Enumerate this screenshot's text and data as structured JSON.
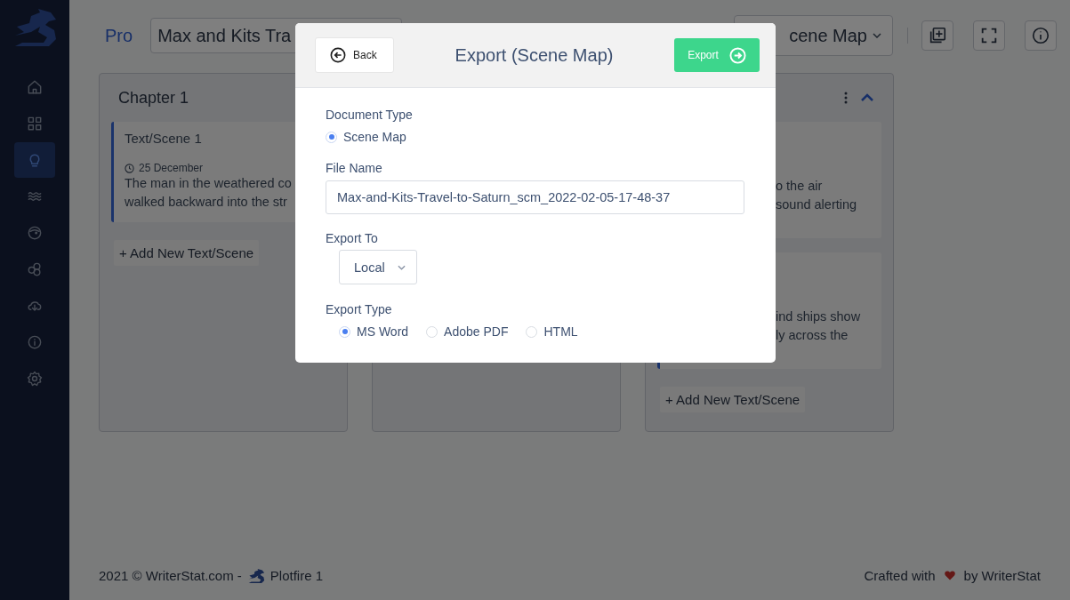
{
  "sidebar": {
    "items": [
      {
        "kind": "home",
        "selected": false
      },
      {
        "kind": "grid",
        "selected": false
      },
      {
        "kind": "bulb",
        "selected": true
      },
      {
        "kind": "waves",
        "selected": false
      },
      {
        "kind": "face",
        "selected": false
      },
      {
        "kind": "circles",
        "selected": false
      },
      {
        "kind": "cloud",
        "selected": false
      },
      {
        "kind": "info",
        "selected": false
      },
      {
        "kind": "gear",
        "selected": false
      }
    ]
  },
  "topbar": {
    "plan": "Pro",
    "title": "Max and Kits Tra",
    "view": "cene Map"
  },
  "columns": [
    {
      "title": "Chapter 1",
      "cards": [
        {
          "title": "Text/Scene 1",
          "date": "25 December",
          "lines": [
            "The man in the weathered co",
            "walked backward into the str"
          ],
          "highlighted": true
        }
      ],
      "add_button": "+ Add New Text/Scene"
    },
    {},
    {
      "expanded": true,
      "cards": [
        {
          "lines": [
            "o the air",
            "sound alerting"
          ]
        },
        {
          "lines": [
            "ind ships show",
            "ly across the"
          ],
          "highlighted": true
        }
      ],
      "add_button": "+ Add New Text/Scene"
    }
  ],
  "dialog": {
    "back": "Back",
    "title": "Export (Scene Map)",
    "export": "Export",
    "document_type": {
      "label": "Document Type",
      "options": [
        {
          "label": "Scene Map",
          "selected": true
        }
      ]
    },
    "file_name": {
      "label": "File Name",
      "value": "Max-and-Kits-Travel-to-Saturn_scm_2022-02-05-17-48-37"
    },
    "export_to": {
      "label": "Export To",
      "value": "Local"
    },
    "export_type": {
      "label": "Export Type",
      "options": [
        {
          "label": "MS Word",
          "selected": true
        },
        {
          "label": "Adobe PDF",
          "selected": false
        },
        {
          "label": "HTML",
          "selected": false
        }
      ]
    }
  },
  "footer": {
    "left": "2021 ©  WriterStat.com -",
    "product": "Plotfire 1",
    "crafted": "Crafted with",
    "by": "by WriterStat"
  }
}
